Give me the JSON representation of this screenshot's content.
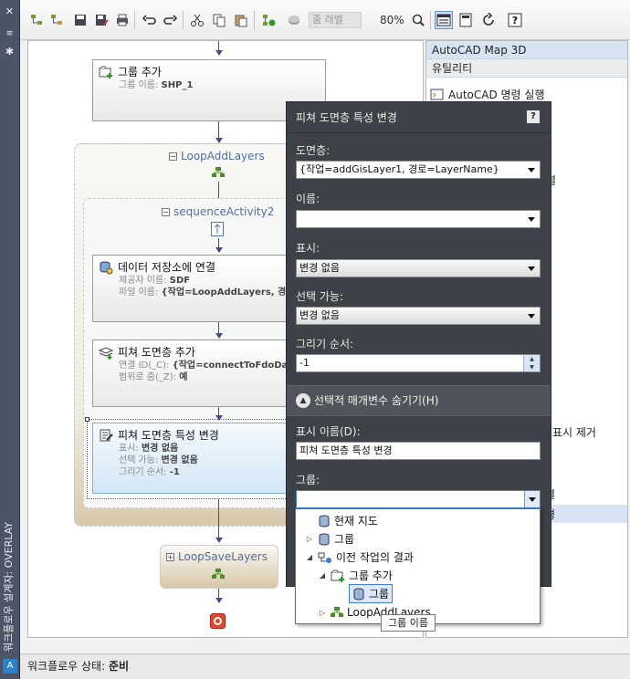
{
  "window": {
    "side_title": "워크플로우 설계자: OVERLAY",
    "close_glyph": "✕",
    "settings_glyph": "✱",
    "brand_glyph": "A"
  },
  "toolbar": {
    "layer_placeholder": "줌 레벨",
    "zoom_percent": "80%"
  },
  "canvas": {
    "group_add": {
      "title": "그룹 추가",
      "prop_label": "그룹 이름:",
      "prop_value": "SHP_1"
    },
    "loop_add": {
      "label": "LoopAddLayers",
      "toggle": "−"
    },
    "sequence": {
      "label": "sequenceActivity2",
      "toggle": "−"
    },
    "connect": {
      "title": "데이터 저장소에 연결",
      "props": [
        {
          "label": "제공자 이름:",
          "value": "SDF"
        },
        {
          "label": "파일 이름:",
          "value": "{작업=LoopAddLayers, 경로"
        }
      ]
    },
    "add_layer": {
      "title": "피쳐 도면층 추가",
      "props": [
        {
          "label": "연결 ID(_C):",
          "value": "{작업=connectToFdoDataS"
        },
        {
          "label": "범위로 줌(_Z):",
          "value": "예"
        }
      ]
    },
    "change_layer": {
      "title": "피쳐 도면층 특성 변경",
      "props": [
        {
          "label": "표시:",
          "value": "변경 없음"
        },
        {
          "label": "선택 가능:",
          "value": "변경 없음"
        },
        {
          "label": "그리기 순서:",
          "value": "-1"
        }
      ]
    },
    "loop_save": {
      "label": "LoopSaveLayers",
      "toggle": "+"
    }
  },
  "right_panel": {
    "header": "AutoCAD Map 3D",
    "subheader": "유틸리티",
    "first_item": "AutoCAD 명령 실행",
    "partial_1": "결",
    "partial_2": "표시 제거",
    "partial_3": "결",
    "partial_4": "경"
  },
  "status": {
    "label": "워크플로우 상태:",
    "value": "준비"
  },
  "prop_window": {
    "title": "피쳐 도면층 특성 변경",
    "help": "?",
    "layer_label": "도면층:",
    "layer_value": "{작업=addGisLayer1, 경로=LayerName}",
    "name_label": "이름:",
    "name_value": "",
    "visible_label": "표시:",
    "visible_value": "변경 없음",
    "selectable_label": "선택 가능:",
    "selectable_value": "변경 없음",
    "draw_order_label": "그리기 순서:",
    "draw_order_value": "-1",
    "section": "선택적 매개변수 숨기기(H)",
    "display_name_label": "표시 이름(D):",
    "display_name_value": "피쳐 도면층 특성 변경",
    "group_label": "그룹:",
    "group_value": ""
  },
  "dropdown": {
    "items": [
      {
        "label": "현재 지도"
      },
      {
        "label": "그룹"
      },
      {
        "label": "이전 작업의 결과"
      },
      {
        "label": "그룹 추가"
      },
      {
        "label": "그룹"
      },
      {
        "label": "LoopAddLayers"
      }
    ],
    "tooltip": "그룹 이름"
  }
}
